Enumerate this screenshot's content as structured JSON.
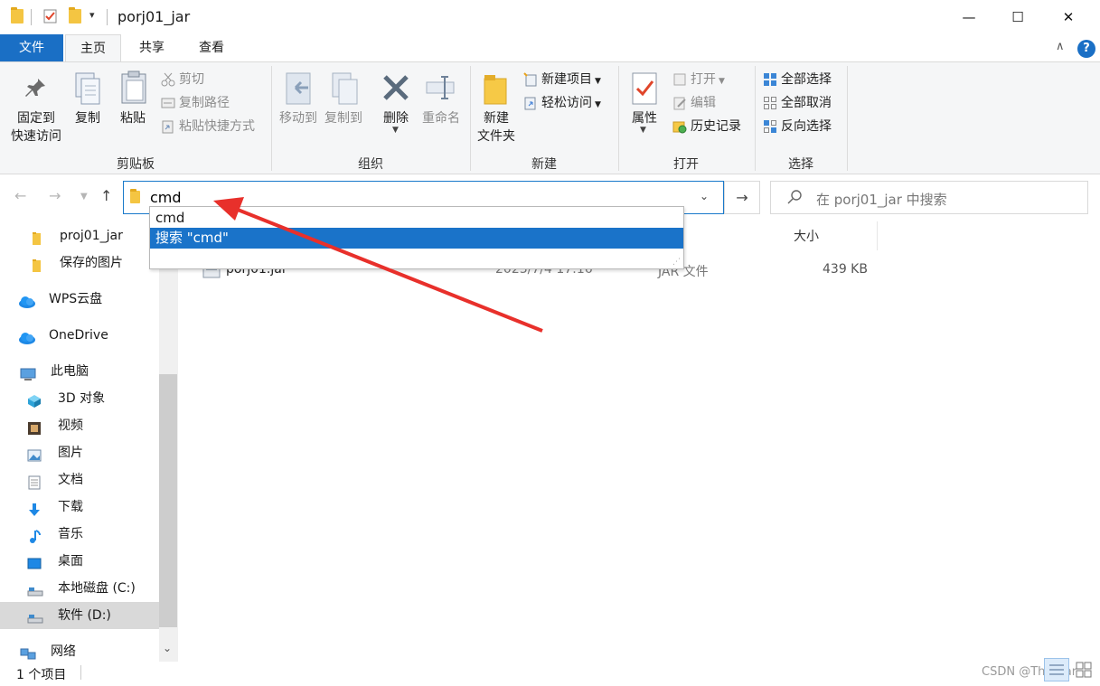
{
  "window": {
    "title": "porj01_jar",
    "minimize": "—",
    "maximize": "☐",
    "close": "✕"
  },
  "ribbon_tabs": [
    "文件",
    "主页",
    "共享",
    "查看"
  ],
  "ribbon": {
    "clipboard": {
      "pin_line1": "固定到",
      "pin_line2": "快速访问",
      "copy": "复制",
      "paste": "粘贴",
      "cut": "剪切",
      "copy_path": "复制路径",
      "paste_shortcut": "粘贴快捷方式",
      "group": "剪贴板"
    },
    "organize": {
      "move_to": "移动到",
      "copy_to": "复制到",
      "delete": "删除",
      "rename": "重命名",
      "group": "组织"
    },
    "new": {
      "new_folder_line1": "新建",
      "new_folder_line2": "文件夹",
      "new_item": "新建项目",
      "easy_access": "轻松访问",
      "group": "新建"
    },
    "open": {
      "properties": "属性",
      "open": "打开",
      "edit": "编辑",
      "history": "历史记录",
      "group": "打开"
    },
    "select": {
      "select_all": "全部选择",
      "select_none": "全部取消",
      "invert": "反向选择",
      "group": "选择"
    }
  },
  "address": {
    "value": "cmd",
    "search_placeholder": "在 porj01_jar 中搜索"
  },
  "suggestions": [
    {
      "label": "cmd",
      "selected": false
    },
    {
      "label": "搜索 \"cmd\"",
      "selected": true
    }
  ],
  "sidebar": [
    {
      "label": "proj01_jar",
      "icon": "folder-icon"
    },
    {
      "label": "保存的图片",
      "icon": "folder-icon"
    },
    {
      "label": "WPS云盘",
      "icon": "cloud-icon"
    },
    {
      "label": "OneDrive",
      "icon": "cloud-icon"
    },
    {
      "label": "此电脑",
      "icon": "computer-icon"
    },
    {
      "label": "3D 对象",
      "icon": "cube-icon"
    },
    {
      "label": "视频",
      "icon": "video-icon"
    },
    {
      "label": "图片",
      "icon": "picture-icon"
    },
    {
      "label": "文档",
      "icon": "document-icon"
    },
    {
      "label": "下载",
      "icon": "download-icon"
    },
    {
      "label": "音乐",
      "icon": "music-icon"
    },
    {
      "label": "桌面",
      "icon": "desktop-icon"
    },
    {
      "label": "本地磁盘 (C:)",
      "icon": "drive-icon"
    },
    {
      "label": "软件 (D:)",
      "icon": "drive-icon"
    },
    {
      "label": "网络",
      "icon": "network-icon"
    }
  ],
  "columns": {
    "size": "大小"
  },
  "files": [
    {
      "name": "porj01.jar",
      "modified": "2023/7/4 17:16",
      "type": "JAR 文件",
      "size": "439 KB"
    }
  ],
  "status": {
    "count": "1 个项目",
    "watermark": "CSDN @TheStar"
  },
  "colors": {
    "accent": "#1a6fc5",
    "arrow": "#e8302b"
  }
}
